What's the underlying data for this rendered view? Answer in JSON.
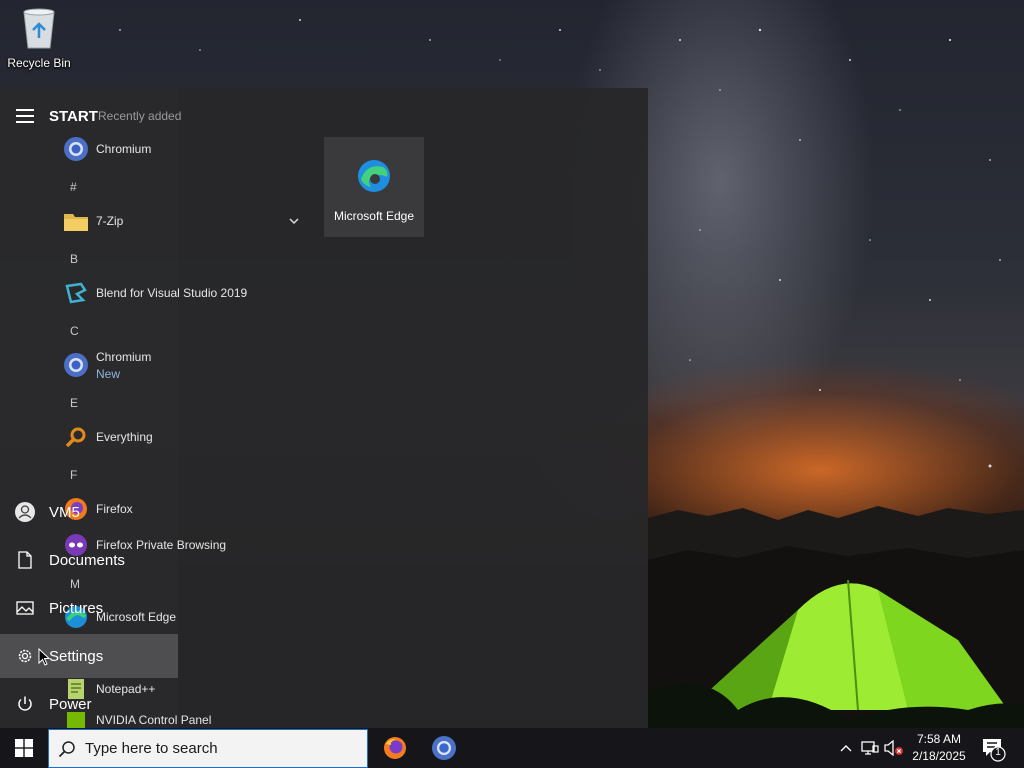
{
  "desktop": {
    "recycle_bin_label": "Recycle Bin"
  },
  "start_menu": {
    "title": "START",
    "recently_added_label": "Recently added",
    "sections": {
      "hash": "#",
      "b": "B",
      "c": "C",
      "e": "E",
      "f": "F",
      "m": "M"
    },
    "apps": {
      "chromium_recent": "Chromium",
      "seven_zip": "7-Zip",
      "blend": "Blend for Visual Studio 2019",
      "chromium": "Chromium",
      "chromium_sub": "New",
      "everything": "Everything",
      "firefox": "Firefox",
      "firefox_private": "Firefox Private Browsing",
      "edge": "Microsoft Edge",
      "notepadpp": "Notepad++",
      "nvidia": "NVIDIA Control Panel"
    },
    "tile": {
      "label": "Microsoft Edge"
    },
    "rail": {
      "user": "VM5",
      "documents": "Documents",
      "pictures": "Pictures",
      "settings": "Settings",
      "power": "Power"
    }
  },
  "taskbar": {
    "search_placeholder": "Type here to search",
    "time": "7:58 AM",
    "date": "2/18/2025",
    "notification_count": "1"
  },
  "colors": {
    "accent": "#1f6fc5",
    "start_bg": "#28282a",
    "taskbar_bg": "#15151a"
  }
}
